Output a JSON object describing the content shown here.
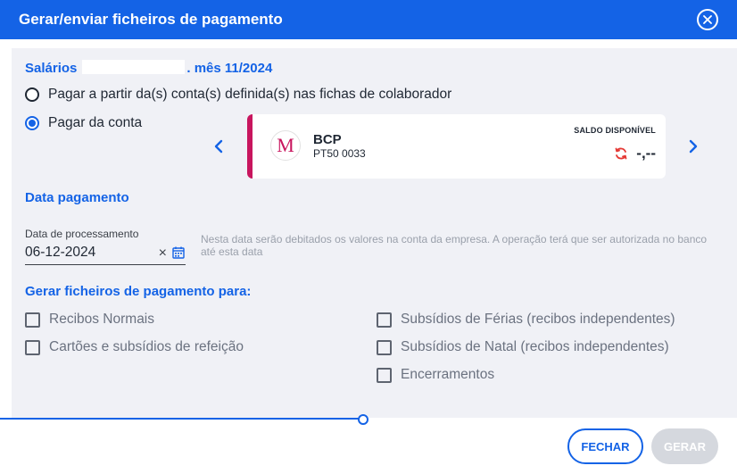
{
  "header": {
    "title": "Gerar/enviar ficheiros de pagamento"
  },
  "salarios": {
    "label": "Salários",
    "period": ". mês 11/2024"
  },
  "payment_options": [
    {
      "label": "Pagar a partir da(s) conta(s) definida(s) nas fichas de colaborador",
      "checked": false
    },
    {
      "label": "Pagar da conta",
      "checked": true
    }
  ],
  "account": {
    "bank_name": "BCP",
    "iban": "PT50 0033",
    "logo_letter": "M",
    "balance_label": "SALDO DISPONÍVEL",
    "balance_value": "-,--",
    "accent_color": "#c8155e"
  },
  "payment_date": {
    "section_title": "Data pagamento",
    "field_label": "Data de processamento",
    "value": "06-12-2024",
    "clear_symbol": "×",
    "hint": "Nesta data serão debitados os valores na conta da empresa. A operação terá que ser autorizada no banco até esta data"
  },
  "files": {
    "section_title": "Gerar ficheiros de pagamento para:",
    "left": [
      {
        "label": "Recibos Normais",
        "checked": false
      },
      {
        "label": "Cartões e subsídios de refeição",
        "checked": false
      }
    ],
    "right": [
      {
        "label": "Subsídios de Férias (recibos independentes)",
        "checked": false
      },
      {
        "label": "Subsídios de Natal (recibos independentes)",
        "checked": false
      },
      {
        "label": "Encerramentos",
        "checked": false
      }
    ]
  },
  "footer": {
    "close_label": "FECHAR",
    "generate_label": "GERAR",
    "generate_enabled": false
  },
  "colors": {
    "primary": "#1463e6",
    "panel": "#f0f1f6",
    "refresh": "#e53935"
  },
  "icons": [
    "close-circle-icon",
    "chevron-left-icon",
    "chevron-right-icon",
    "refresh-icon",
    "calendar-icon",
    "bank-logo-icon"
  ]
}
